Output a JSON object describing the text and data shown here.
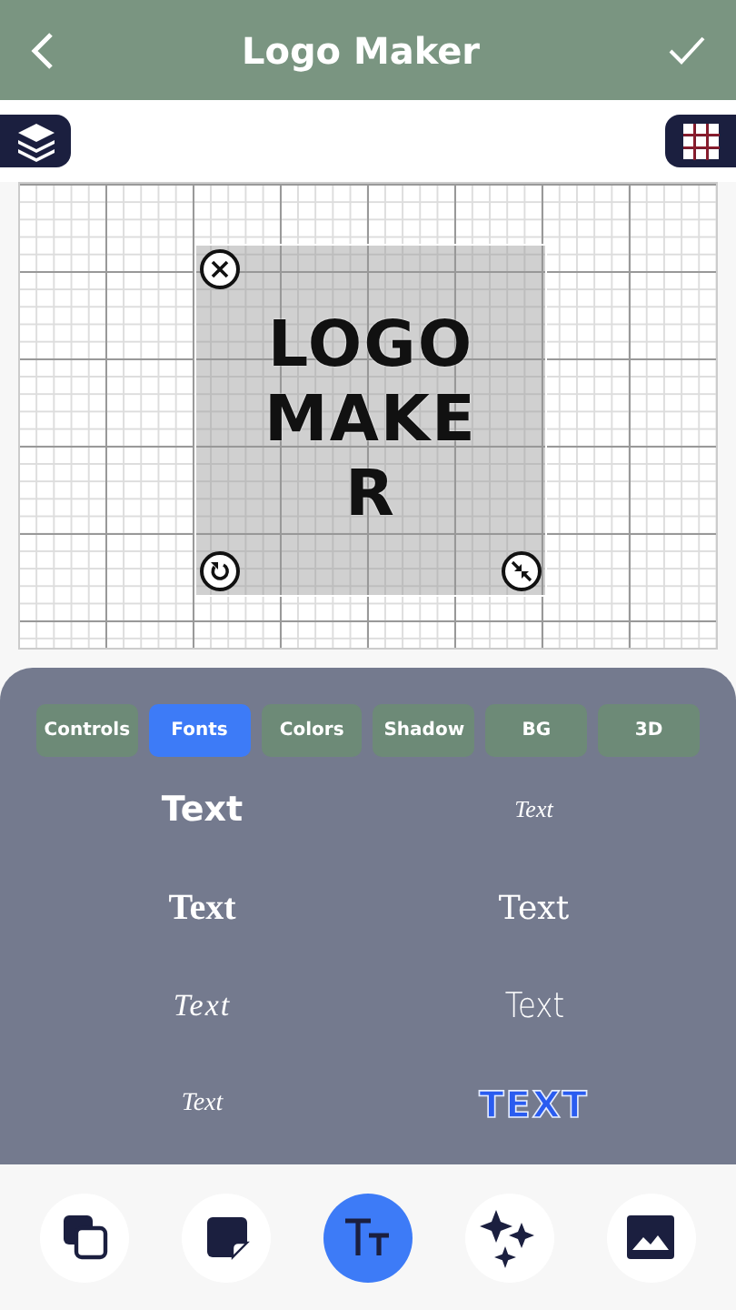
{
  "header": {
    "title": "Logo Maker"
  },
  "canvas": {
    "logo_lines": [
      "LOGO",
      "MAKE",
      "R"
    ]
  },
  "tabs": [
    {
      "label": "Controls",
      "selected": false
    },
    {
      "label": "Fonts",
      "selected": true
    },
    {
      "label": "Colors",
      "selected": false
    },
    {
      "label": "Shadow",
      "selected": false
    },
    {
      "label": "BG",
      "selected": false
    },
    {
      "label": "3D",
      "selected": false
    }
  ],
  "font_samples": [
    {
      "text": "Text",
      "kind": "sans"
    },
    {
      "text": "Text",
      "kind": "thin"
    },
    {
      "text": "Text",
      "kind": "serif"
    },
    {
      "text": "Text",
      "kind": "serif-light"
    },
    {
      "text": "Text",
      "kind": "fancy"
    },
    {
      "text": "Text",
      "kind": "narrow"
    },
    {
      "text": "Text",
      "kind": "script"
    },
    {
      "text": "TEXT",
      "kind": "block"
    }
  ],
  "bottom_tools": [
    {
      "kind": "duplicate",
      "selected": false
    },
    {
      "kind": "sticker",
      "selected": false
    },
    {
      "kind": "text",
      "selected": true
    },
    {
      "kind": "effects",
      "selected": false
    },
    {
      "kind": "image",
      "selected": false
    }
  ]
}
